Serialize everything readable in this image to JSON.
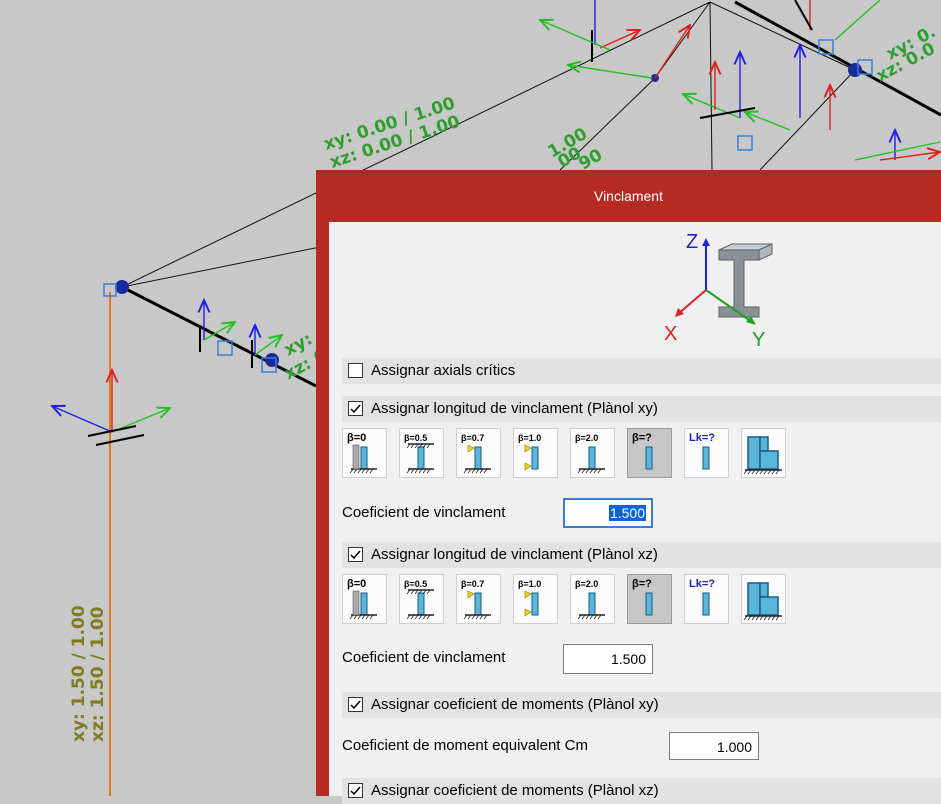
{
  "viewport": {
    "member_labels": [
      {
        "xy": "xy: 0.00 / 1.00",
        "xz": "xz: 0.00 / 1.00"
      },
      {
        "xy": "xy: 1.50 / 1.00",
        "xz": "xz: 1.50 / 1.00"
      }
    ],
    "partial_labels": [
      "xy: 0.",
      "xz: 0.0",
      "1.00",
      "00",
      "90",
      "xy:",
      "xz: 0"
    ],
    "colors": {
      "label_green": "#2f9e2f",
      "label_olive": "#7d7d1e",
      "member_orange": "#e07a1e",
      "node_blue": "#1a2a9a"
    }
  },
  "dialog": {
    "title": "Vinclament",
    "axes_icon": {
      "z": "Z",
      "x": "X",
      "y": "Y"
    },
    "sections": [
      {
        "id": "axials",
        "label": "Assignar axials crítics",
        "checked": false
      },
      {
        "id": "len_xy",
        "label": "Assignar longitud de vinclament (Plànol xy)",
        "checked": true
      },
      {
        "id": "len_xz",
        "label": "Assignar longitud de vinclament (Plànol xz)",
        "checked": true
      },
      {
        "id": "mom_xy",
        "label": "Assignar coeficient de moments (Plànol xy)",
        "checked": true
      },
      {
        "id": "mom_xz",
        "label": "Assignar coeficient de moments (Plànol xz)",
        "checked": true
      }
    ],
    "beta_buttons": [
      {
        "label": "β=0",
        "icon": "beta-0-icon"
      },
      {
        "label": "β=0.5",
        "icon": "beta-0.5-icon"
      },
      {
        "label": "β=0.7",
        "icon": "beta-0.7-icon"
      },
      {
        "label": "β=1.0",
        "icon": "beta-1.0-icon"
      },
      {
        "label": "β=2.0",
        "icon": "beta-2.0-icon"
      },
      {
        "label": "β=?",
        "icon": "beta-custom-icon",
        "active": true
      },
      {
        "label": "Lk=?",
        "icon": "lk-custom-icon"
      },
      {
        "label": "",
        "icon": "frame-icon"
      }
    ],
    "coef_xy": {
      "label": "Coeficient de vinclament",
      "value": "1.500"
    },
    "coef_xz": {
      "label": "Coeficient de vinclament",
      "value": "1.500"
    },
    "cm_xy": {
      "label": "Coeficient de moment equivalent Cm",
      "value": "1.000"
    },
    "colors": {
      "title_bar": "#b72a22",
      "section_bg": "#e2e2e2",
      "body_bg": "#f0f0f0",
      "active_button": "#c6c6c6"
    }
  }
}
